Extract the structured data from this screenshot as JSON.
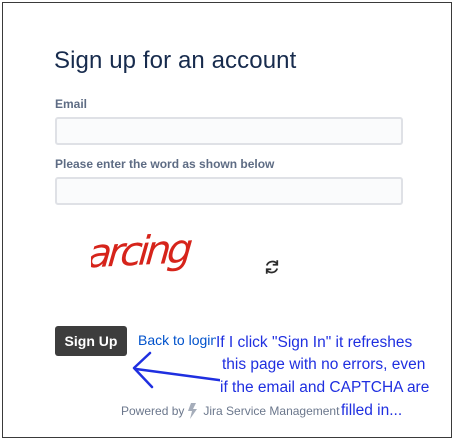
{
  "form": {
    "title": "Sign up for an account",
    "email_label": "Email",
    "email_value": "",
    "captcha_label": "Please enter the word as shown below",
    "captcha_value": "",
    "captcha_word": "arcing",
    "signup_label": "Sign Up",
    "back_link": "Back to login"
  },
  "footer": {
    "powered_by": "Powered by",
    "product": "Jira Service Management"
  },
  "annotation": {
    "lines": [
      "If I click \"Sign In\" it refreshes",
      "this page with no errors, even",
      "if the email and CAPTCHA are",
      "filled in..."
    ],
    "color": "#1f2fe0"
  },
  "icons": {
    "refresh": "refresh-icon",
    "bolt": "jira-bolt-icon",
    "arrow": "annotation-arrow-icon"
  },
  "colors": {
    "title": "#172B4D",
    "label": "#5E6C84",
    "button_bg": "#3d3d3d",
    "link": "#0052CC",
    "captcha": "#d6241b"
  }
}
